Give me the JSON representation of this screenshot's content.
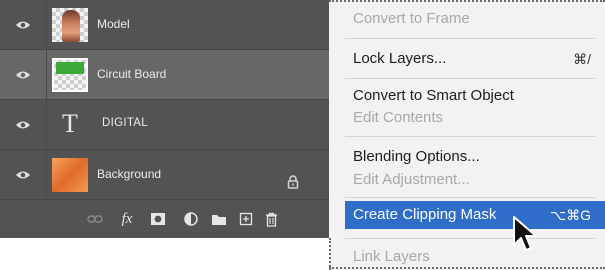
{
  "layers_panel": {
    "layers": [
      {
        "name": "Model",
        "thumbnail": "model-photo",
        "selected": false
      },
      {
        "name": "Circuit Board",
        "thumbnail": "circuit-board-image",
        "selected": true
      },
      {
        "name": "DIGITAL",
        "thumbnail": "type-layer",
        "selected": false
      },
      {
        "name": "Background",
        "thumbnail": "orange-background",
        "locked": true,
        "selected": false
      }
    ],
    "type_glyph": "T",
    "toolbar": {
      "fx_label": "fx"
    }
  },
  "context_menu": {
    "items": [
      {
        "label": "Convert to Frame",
        "enabled": false
      },
      {
        "label": "Lock Layers...",
        "shortcut": "⌘/",
        "enabled": true
      },
      {
        "label": "Convert to Smart Object",
        "enabled": true
      },
      {
        "label": "Edit Contents",
        "enabled": false
      },
      {
        "label": "Blending Options...",
        "enabled": true
      },
      {
        "label": "Edit Adjustment...",
        "enabled": false
      },
      {
        "label": "Create Clipping Mask",
        "shortcut": "⌥⌘G",
        "enabled": true,
        "highlighted": true
      },
      {
        "label": "Link Layers",
        "enabled": false
      }
    ]
  },
  "colors": {
    "panel_bg": "#535353",
    "selected_row": "#676767",
    "menu_bg": "#f2f2f2",
    "menu_highlight": "#2e6dc8"
  }
}
